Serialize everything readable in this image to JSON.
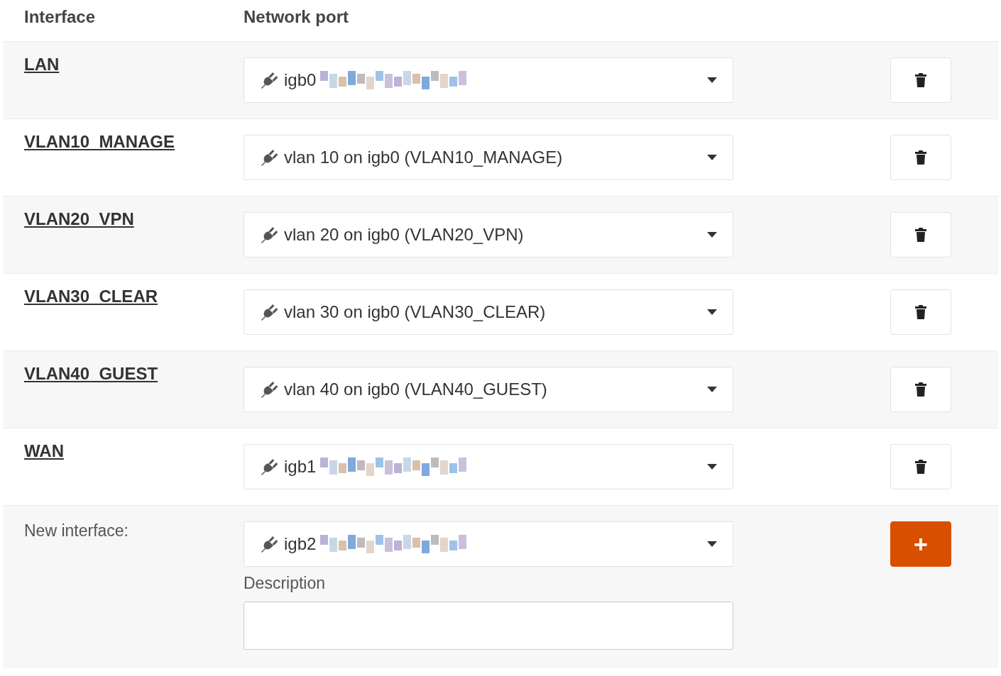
{
  "columns": [
    "Interface",
    "Network port"
  ],
  "rows": [
    {
      "interface": "LAN",
      "port": "igb0",
      "redacted": true
    },
    {
      "interface": "VLAN10_MANAGE",
      "port": "vlan 10 on igb0 (VLAN10_MANAGE)",
      "redacted": false
    },
    {
      "interface": "VLAN20_VPN",
      "port": "vlan 20 on igb0 (VLAN20_VPN)",
      "redacted": false
    },
    {
      "interface": "VLAN30_CLEAR",
      "port": "vlan 30 on igb0 (VLAN30_CLEAR)",
      "redacted": false
    },
    {
      "interface": "VLAN40_GUEST",
      "port": "vlan 40 on igb0 (VLAN40_GUEST)",
      "redacted": false
    },
    {
      "interface": "WAN",
      "port": "igb1",
      "redacted": true
    }
  ],
  "new_interface": {
    "label": "New interface:",
    "port": "igb2",
    "redacted": true,
    "description_label": "Description",
    "add_button": "+"
  }
}
